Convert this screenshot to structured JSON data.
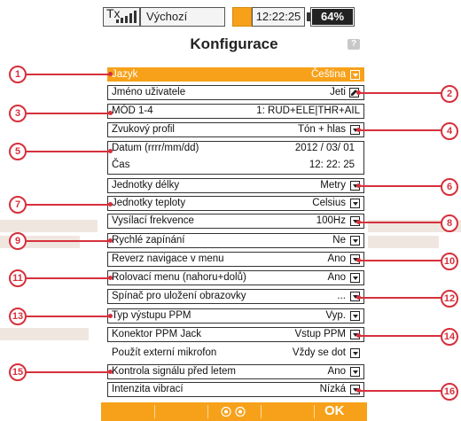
{
  "status": {
    "tx_label": "Tx",
    "model_name": "Výchozí",
    "time": "12:22:25",
    "battery": "64%"
  },
  "title": "Konfigurace",
  "rows": [
    {
      "label": "Jazyk",
      "value": "Čeština",
      "control": "dropdown",
      "selected": true
    },
    {
      "label": "Jméno uživatele",
      "value": "Jeti",
      "control": "edit"
    },
    {
      "label": "MÓD 1-4",
      "value": "1: RUD+ELE|THR+AIL",
      "control": "none"
    },
    {
      "label": "Zvukový profil",
      "value": "Tón + hlas",
      "control": "dropdown"
    },
    {
      "label": "Datum (rrrr/mm/dd)",
      "value": "2012 / 03/ 01",
      "control": "none"
    },
    {
      "label": "Čas",
      "value": "12: 22: 25",
      "control": "none"
    },
    {
      "label": "Jednotky délky",
      "value": "Metry",
      "control": "dropdown"
    },
    {
      "label": "Jednotky teploty",
      "value": "Celsius",
      "control": "dropdown"
    },
    {
      "label": "Vysílací frekvence",
      "value": "100Hz",
      "control": "dropdown"
    },
    {
      "label": "Rychlé zapínání",
      "value": "Ne",
      "control": "dropdown"
    },
    {
      "label": "Reverz navigace v menu",
      "value": "Ano",
      "control": "dropdown"
    },
    {
      "label": "Rolovací menu (nahoru+dolů)",
      "value": "Ano",
      "control": "dropdown"
    },
    {
      "label": "Spínač pro uložení obrazovky",
      "value": "...",
      "control": "dropdown"
    },
    {
      "label": "Typ výstupu PPM",
      "value": "Vyp.",
      "control": "dropdown"
    },
    {
      "label": "Konektor PPM Jack",
      "value": "Vstup PPM",
      "control": "dropdown"
    },
    {
      "label": "Použít externí mikrofon",
      "value": "Vždy se dot",
      "control": "dropdown"
    },
    {
      "label": "Kontrola signálu před letem",
      "value": "Ano",
      "control": "dropdown"
    },
    {
      "label": "Intenzita vibrací",
      "value": "Nízká",
      "control": "dropdown"
    }
  ],
  "bottom": {
    "ok": "OK"
  },
  "callouts": [
    "1",
    "2",
    "3",
    "4",
    "5",
    "6",
    "7",
    "8",
    "9",
    "10",
    "11",
    "12",
    "13",
    "14",
    "15",
    "16"
  ],
  "colors": {
    "accent": "#f7a11a",
    "callout": "#d6303c"
  }
}
